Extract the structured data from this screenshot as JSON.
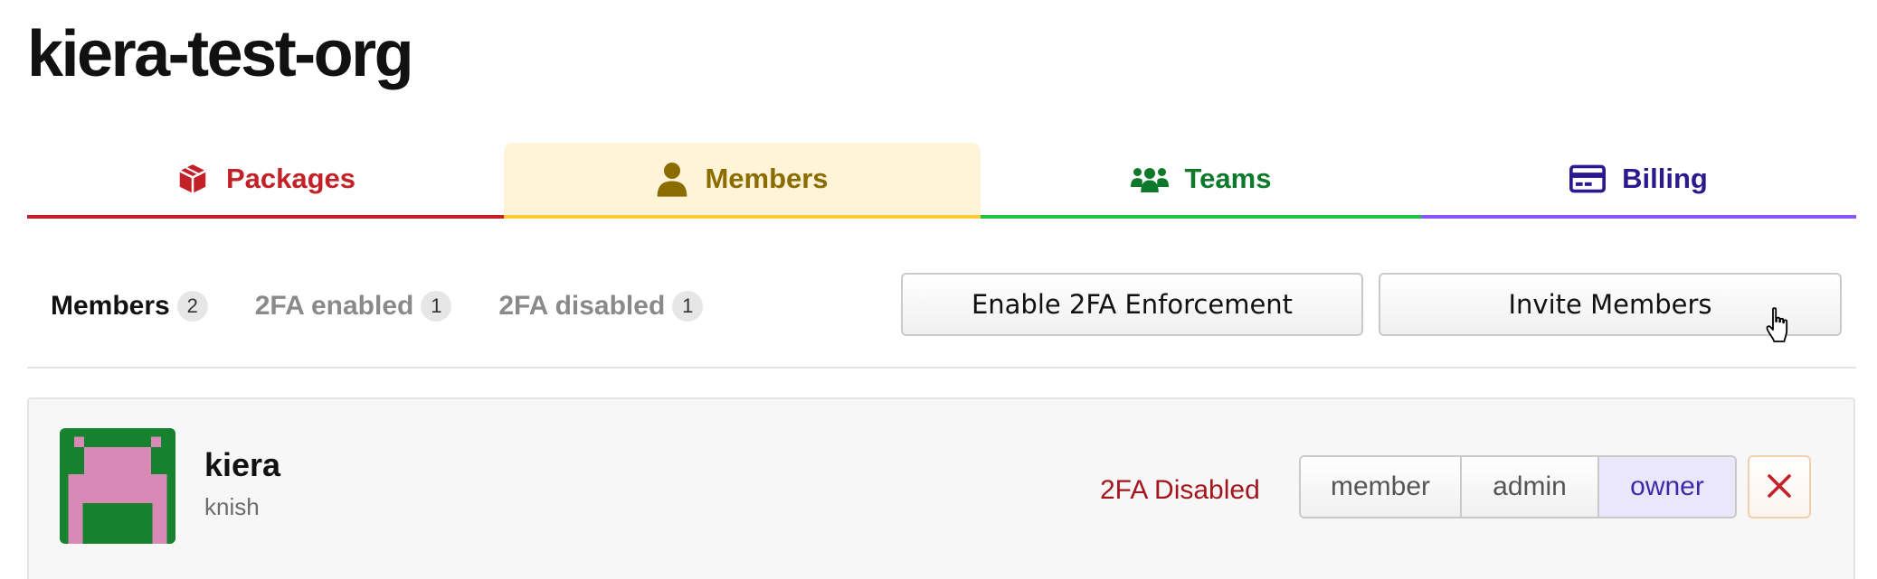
{
  "org": {
    "title": "kiera-test-org"
  },
  "tabs": [
    {
      "label": "Packages",
      "icon": "package-icon",
      "color": "#c12127"
    },
    {
      "label": "Members",
      "icon": "user-icon",
      "color": "#8a6c00",
      "active": true
    },
    {
      "label": "Teams",
      "icon": "users-icon",
      "color": "#0d7a2b"
    },
    {
      "label": "Billing",
      "icon": "credit-card-icon",
      "color": "#2b1a8f"
    }
  ],
  "filters": [
    {
      "label": "Members",
      "count": "2",
      "active": true
    },
    {
      "label": "2FA enabled",
      "count": "1"
    },
    {
      "label": "2FA disabled",
      "count": "1"
    }
  ],
  "actions": {
    "enable_2fa_label": "Enable 2FA Enforcement",
    "invite_label": "Invite Members"
  },
  "members": [
    {
      "name": "kiera",
      "username": "knish",
      "two_factor_status": "2FA Disabled",
      "roles": [
        "member",
        "admin",
        "owner"
      ],
      "selected_role": "owner",
      "avatar_colors": {
        "background": "#168230",
        "figure": "#d889b6"
      }
    }
  ],
  "colors": {
    "packages_accent": "#c12127",
    "members_accent": "#ffcd3a",
    "teams_accent": "#23c143",
    "billing_accent": "#8956ff",
    "danger": "#a3161c"
  }
}
